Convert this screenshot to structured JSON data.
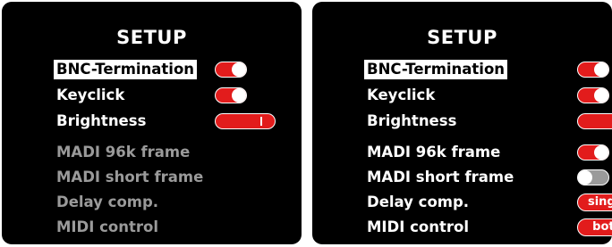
{
  "colors": {
    "accent": "#e21c1c",
    "disabled_text": "#9a9a9a",
    "off_toggle": "#9a9a9a",
    "background": "#000000",
    "text": "#ffffff"
  },
  "left_panel": {
    "title": "SETUP",
    "items": [
      {
        "label": "BNC-Termination",
        "control": "toggle",
        "state": "on",
        "selected": true
      },
      {
        "label": "Keyclick",
        "control": "toggle",
        "state": "on"
      },
      {
        "label": "Brightness",
        "control": "slider",
        "level": 0.9
      },
      {
        "label": "MADI 96k frame",
        "control": "none",
        "disabled": true
      },
      {
        "label": "MADI short frame",
        "control": "none",
        "disabled": true
      },
      {
        "label": "Delay comp.",
        "control": "none",
        "disabled": true
      },
      {
        "label": "MIDI control",
        "control": "none",
        "disabled": true
      }
    ]
  },
  "right_panel": {
    "title": "SETUP",
    "items": [
      {
        "label": "BNC-Termination",
        "control": "toggle",
        "state": "on",
        "selected": true
      },
      {
        "label": "Keyclick",
        "control": "toggle",
        "state": "on"
      },
      {
        "label": "Brightness",
        "control": "slider",
        "level": 0.9
      },
      {
        "label": "MADI 96k frame",
        "control": "toggle",
        "state": "on"
      },
      {
        "label": "MADI short frame",
        "control": "toggle",
        "state": "off"
      },
      {
        "label": "Delay comp.",
        "control": "pill",
        "value": "single"
      },
      {
        "label": "MIDI control",
        "control": "pill",
        "value": "both"
      }
    ]
  }
}
